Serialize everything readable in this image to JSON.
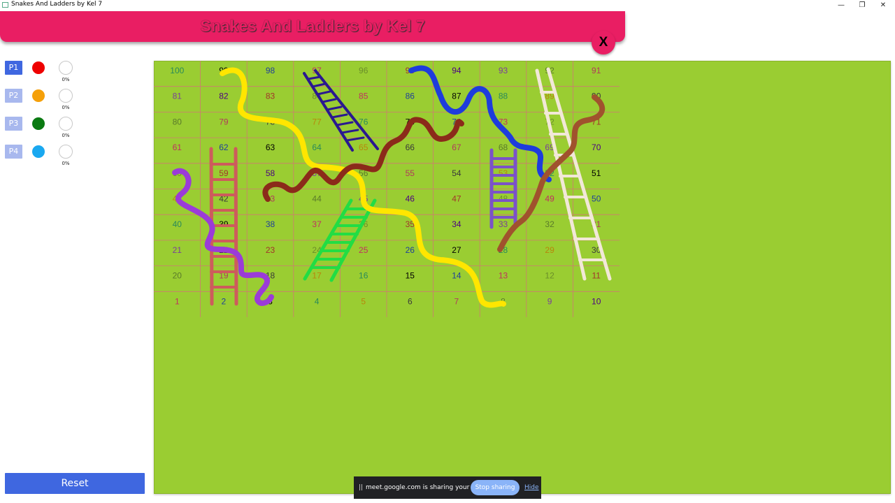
{
  "window": {
    "title": "Snakes And Ladders by Kel 7",
    "minimize": "—",
    "restore": "❐",
    "close": "✕"
  },
  "header": {
    "title": "Snakes And Ladders by Kel 7",
    "close_label": "X",
    "color": "#e91e63"
  },
  "players": [
    {
      "label": "P1",
      "color": "#ee0000",
      "progress": "0%",
      "active": true
    },
    {
      "label": "P2",
      "color": "#f5a00a",
      "progress": "0%",
      "active": false
    },
    {
      "label": "P3",
      "color": "#0a7a12",
      "progress": "0%",
      "active": false
    },
    {
      "label": "P4",
      "color": "#1aa8f0",
      "progress": "0%",
      "active": false
    }
  ],
  "reset_label": "Reset",
  "board": {
    "background": "#9acd32",
    "rows": [
      [
        100,
        99,
        98,
        97,
        96,
        95,
        94,
        93,
        92,
        91
      ],
      [
        81,
        82,
        83,
        84,
        85,
        86,
        87,
        88,
        89,
        90
      ],
      [
        80,
        79,
        78,
        77,
        76,
        75,
        74,
        73,
        72,
        71
      ],
      [
        61,
        62,
        63,
        64,
        65,
        66,
        67,
        68,
        69,
        70
      ],
      [
        60,
        59,
        58,
        57,
        56,
        55,
        54,
        53,
        52,
        51
      ],
      [
        41,
        42,
        43,
        44,
        45,
        46,
        47,
        48,
        49,
        50
      ],
      [
        40,
        39,
        38,
        37,
        36,
        35,
        34,
        33,
        32,
        31
      ],
      [
        21,
        22,
        23,
        24,
        25,
        26,
        27,
        28,
        29,
        30
      ],
      [
        20,
        19,
        18,
        17,
        16,
        15,
        14,
        13,
        12,
        11
      ],
      [
        1,
        2,
        3,
        4,
        5,
        6,
        7,
        8,
        9,
        10
      ]
    ],
    "ladders": [
      {
        "color": "#2a1890"
      },
      {
        "color": "#f2e8d8"
      },
      {
        "color": "#cd5c5c"
      },
      {
        "color": "#22dd44"
      },
      {
        "color": "#7b52c8"
      }
    ],
    "snakes": [
      {
        "color": "#ffe600"
      },
      {
        "color": "#1e3cdc"
      },
      {
        "color": "#8b2a1a"
      },
      {
        "color": "#9b3bd8"
      },
      {
        "color": "#a0522d"
      }
    ]
  },
  "screen_share": {
    "pause": "||",
    "text": "meet.google.com is sharing your screen.",
    "stop_label": "Stop sharing",
    "hide_label": "Hide"
  }
}
